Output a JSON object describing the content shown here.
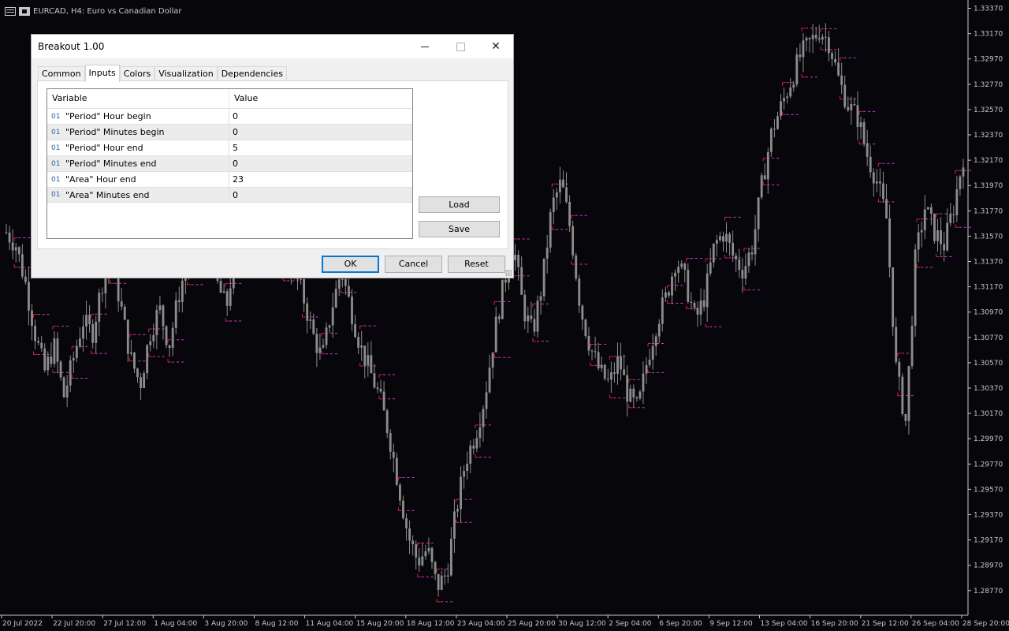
{
  "window": {
    "title": "EURCAD, H4:  Euro vs Canadian Dollar"
  },
  "dialog": {
    "title": "Breakout 1.00",
    "tabs": [
      {
        "label": "Common",
        "active": false
      },
      {
        "label": "Inputs",
        "active": true
      },
      {
        "label": "Colors",
        "active": false
      },
      {
        "label": "Visualization",
        "active": false
      },
      {
        "label": "Dependencies",
        "active": false
      }
    ],
    "columns": {
      "variable": "Variable",
      "value": "Value"
    },
    "rows": [
      {
        "type": "01",
        "variable": "\"Period\" Hour begin",
        "value": "0"
      },
      {
        "type": "01",
        "variable": "\"Period\" Minutes begin",
        "value": "0"
      },
      {
        "type": "01",
        "variable": "\"Period\" Hour end",
        "value": "5"
      },
      {
        "type": "01",
        "variable": "\"Period\" Minutes end",
        "value": "0"
      },
      {
        "type": "01",
        "variable": "\"Area\" Hour end",
        "value": "23"
      },
      {
        "type": "01",
        "variable": "\"Area\" Minutes end",
        "value": "0"
      }
    ],
    "buttons": {
      "load": "Load",
      "save": "Save",
      "ok": "OK",
      "cancel": "Cancel",
      "reset": "Reset"
    }
  },
  "chart_data": {
    "type": "candlestick",
    "colors": {
      "candle": "#8c8c8c",
      "marker_high": "#e01c4c",
      "marker_dash": "#d336d3",
      "background": "#07070b",
      "axis_text": "#c8c8c8"
    },
    "ylim": [
      1.2865,
      1.3345
    ],
    "y_ticks": [
      "1.33370",
      "1.33170",
      "1.32970",
      "1.32770",
      "1.32570",
      "1.32370",
      "1.32170",
      "1.31970",
      "1.31770",
      "1.31570",
      "1.31370",
      "1.31170",
      "1.30970",
      "1.30770",
      "1.30570",
      "1.30370",
      "1.30170",
      "1.29970",
      "1.29770",
      "1.29570",
      "1.29370",
      "1.29170",
      "1.28970",
      "1.28770"
    ],
    "x_ticks": [
      "20 Jul 2022",
      "22 Jul 20:00",
      "27 Jul 12:00",
      "1 Aug 04:00",
      "3 Aug 20:00",
      "8 Aug 12:00",
      "11 Aug 04:00",
      "15 Aug 20:00",
      "18 Aug 12:00",
      "23 Aug 04:00",
      "25 Aug 20:00",
      "30 Aug 12:00",
      "2 Sep 04:00",
      "6 Sep 20:00",
      "9 Sep 12:00",
      "13 Sep 04:00",
      "16 Sep 20:00",
      "21 Sep 12:00",
      "26 Sep 04:00",
      "28 Sep 20:00"
    ],
    "close_path": [
      1.316,
      1.315,
      1.312,
      1.308,
      1.305,
      1.307,
      1.303,
      1.306,
      1.309,
      1.308,
      1.312,
      1.314,
      1.31,
      1.306,
      1.304,
      1.308,
      1.31,
      1.307,
      1.311,
      1.314,
      1.317,
      1.315,
      1.312,
      1.31,
      1.315,
      1.317,
      1.32,
      1.318,
      1.316,
      1.314,
      1.313,
      1.311,
      1.308,
      1.306,
      1.31,
      1.313,
      1.31,
      1.307,
      1.305,
      1.303,
      1.3,
      1.296,
      1.292,
      1.29,
      1.291,
      1.288,
      1.289,
      1.294,
      1.298,
      1.3,
      1.303,
      1.308,
      1.312,
      1.315,
      1.31,
      1.308,
      1.312,
      1.318,
      1.32,
      1.316,
      1.31,
      1.307,
      1.305,
      1.304,
      1.306,
      1.303,
      1.302,
      1.306,
      1.309,
      1.311,
      1.314,
      1.312,
      1.309,
      1.311,
      1.315,
      1.316,
      1.314,
      1.313,
      1.315,
      1.32,
      1.324,
      1.326,
      1.328,
      1.33,
      1.331,
      1.332,
      1.331,
      1.328,
      1.326,
      1.325,
      1.322,
      1.32,
      1.317,
      1.305,
      1.301,
      1.314,
      1.318,
      1.316,
      1.315,
      1.318,
      1.322
    ]
  }
}
